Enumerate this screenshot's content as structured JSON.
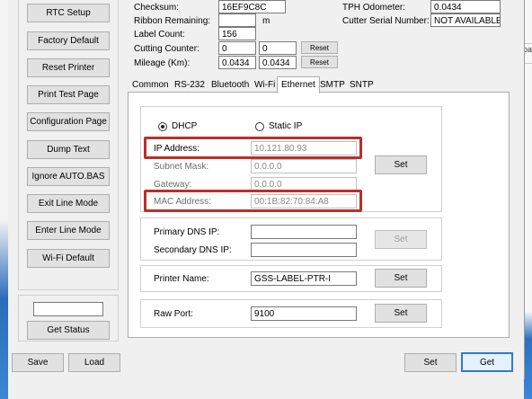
{
  "side_buttons": [
    "RTC Setup",
    "Factory Default",
    "Reset Printer",
    "Print Test Page",
    "Configuration Page",
    "Dump Text",
    "Ignore AUTO.BAS",
    "Exit Line Mode",
    "Enter Line Mode",
    "Wi-Fi Default"
  ],
  "get_status_label": "Get Status",
  "status_input_value": "",
  "info": {
    "checksum_label": "Checksum:",
    "checksum_value": "16EF9C8C",
    "ribbon_label": "Ribbon Remaining:",
    "ribbon_value": "",
    "ribbon_unit": "m",
    "label_count_label": "Label Count:",
    "label_count_value": "156",
    "cutting_label": "Cutting Counter:",
    "cutting_value1": "0",
    "cutting_value2": "0",
    "mileage_label": "Mileage (Km):",
    "mileage_value1": "0.0434",
    "mileage_value2": "0.0434",
    "reset_label": "Reset",
    "tph_label": "TPH Odometer:",
    "tph_value": "0.0434",
    "cutter_serial_label": "Cutter Serial Number:",
    "cutter_serial_value": "NOT AVAILABLE"
  },
  "tabs": [
    "Common",
    "RS-232",
    "Bluetooth",
    "Wi-Fi",
    "Ethernet",
    "SMTP",
    "SNTP"
  ],
  "active_tab": "Ethernet",
  "ethernet": {
    "dhcp_label": "DHCP",
    "static_ip_label": "Static IP",
    "mode": "DHCP",
    "ip_label": "IP Address:",
    "ip_value": "10.121.80.93",
    "subnet_label": "Subnet Mask:",
    "subnet_value": "0.0.0.0",
    "gateway_label": "Gateway:",
    "gateway_value": "0.0.0.0",
    "mac_label": "MAC Address:",
    "mac_value": "00:1B:82:70:84:A8",
    "primary_dns_label": "Primary DNS IP:",
    "primary_dns_value": "",
    "secondary_dns_label": "Secondary DNS IP:",
    "secondary_dns_value": "",
    "printer_name_label": "Printer Name:",
    "printer_name_value": "GSS-LABEL-PTR-I",
    "raw_port_label": "Raw Port:",
    "raw_port_value": "9100",
    "set_label": "Set"
  },
  "bottom": {
    "save_label": "Save",
    "load_label": "Load",
    "set_label": "Set",
    "get_label": "Get"
  },
  "desktop": {
    "right_partial_text": "oad"
  },
  "colors": {
    "highlight": "#b8302a",
    "focus": "#2d7bd0",
    "desktop": "#3a7cc7"
  }
}
